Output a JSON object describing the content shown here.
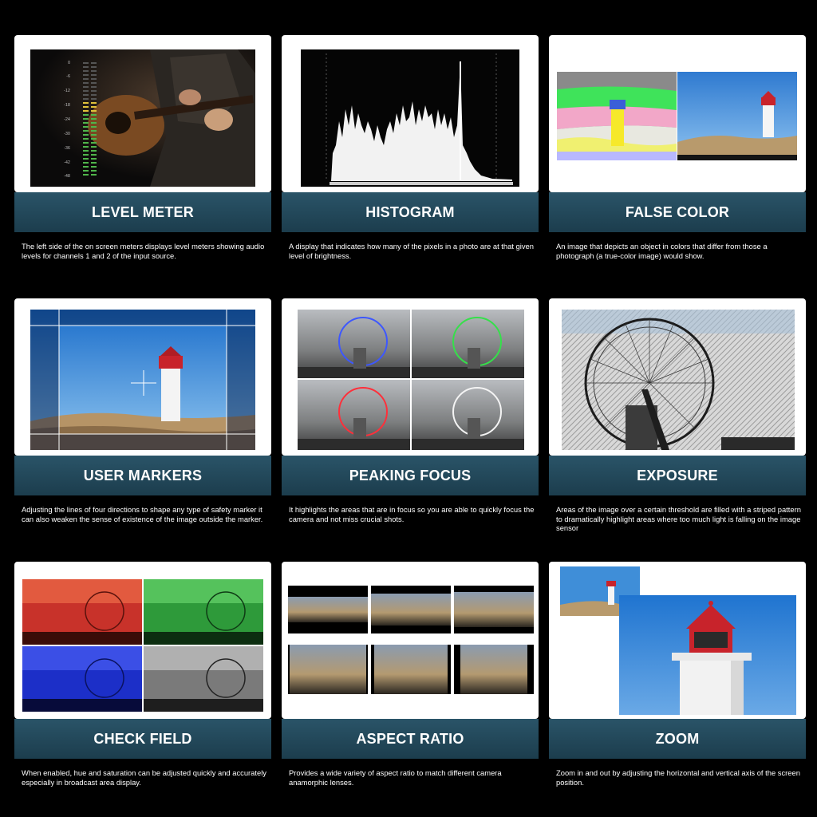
{
  "cards": [
    {
      "title": "LEVEL METER",
      "description": "The left side of the on screen meters displays level meters showing audio levels for channels 1 and 2 of the input source."
    },
    {
      "title": "HISTOGRAM",
      "description": "A display that indicates how many of the pixels in a photo are at that given level of brightness."
    },
    {
      "title": "FALSE COLOR",
      "description": "An image that depicts an object in colors that differ from those a photograph (a true-color image) would show."
    },
    {
      "title": "USER MARKERS",
      "description": "Adjusting the lines of four directions to shape any type of safety marker it can also weaken the sense of existence of the image outside the marker."
    },
    {
      "title": "PEAKING FOCUS",
      "description": "It highlights the areas that are in focus so you are able to quickly focus the camera and not miss crucial shots."
    },
    {
      "title": "EXPOSURE",
      "description": "Areas of the image over a certain threshold are filled with a striped pattern to dramatically highlight areas where too much light is falling on the image sensor"
    },
    {
      "title": "CHECK FIELD",
      "description": "When enabled, hue and saturation can be adjusted quickly and accurately especially in broadcast area display."
    },
    {
      "title": "ASPECT RATIO",
      "description": "Provides a wide variety of aspect ratio to match different camera anamorphic lenses."
    },
    {
      "title": "ZOOM",
      "description": "Zoom in and out by adjusting the horizontal and vertical axis of the screen position."
    }
  ],
  "level_meter": {
    "scale": [
      "0",
      "-6",
      "-12",
      "-18",
      "-24",
      "-30",
      "-36",
      "-42",
      "-48"
    ]
  },
  "colors": {
    "title_bar_top": "#2a5468",
    "title_bar_bottom": "#1c3d4d",
    "lighthouse_red": "#c8232b",
    "sky_blue": "#3f8ed8"
  }
}
